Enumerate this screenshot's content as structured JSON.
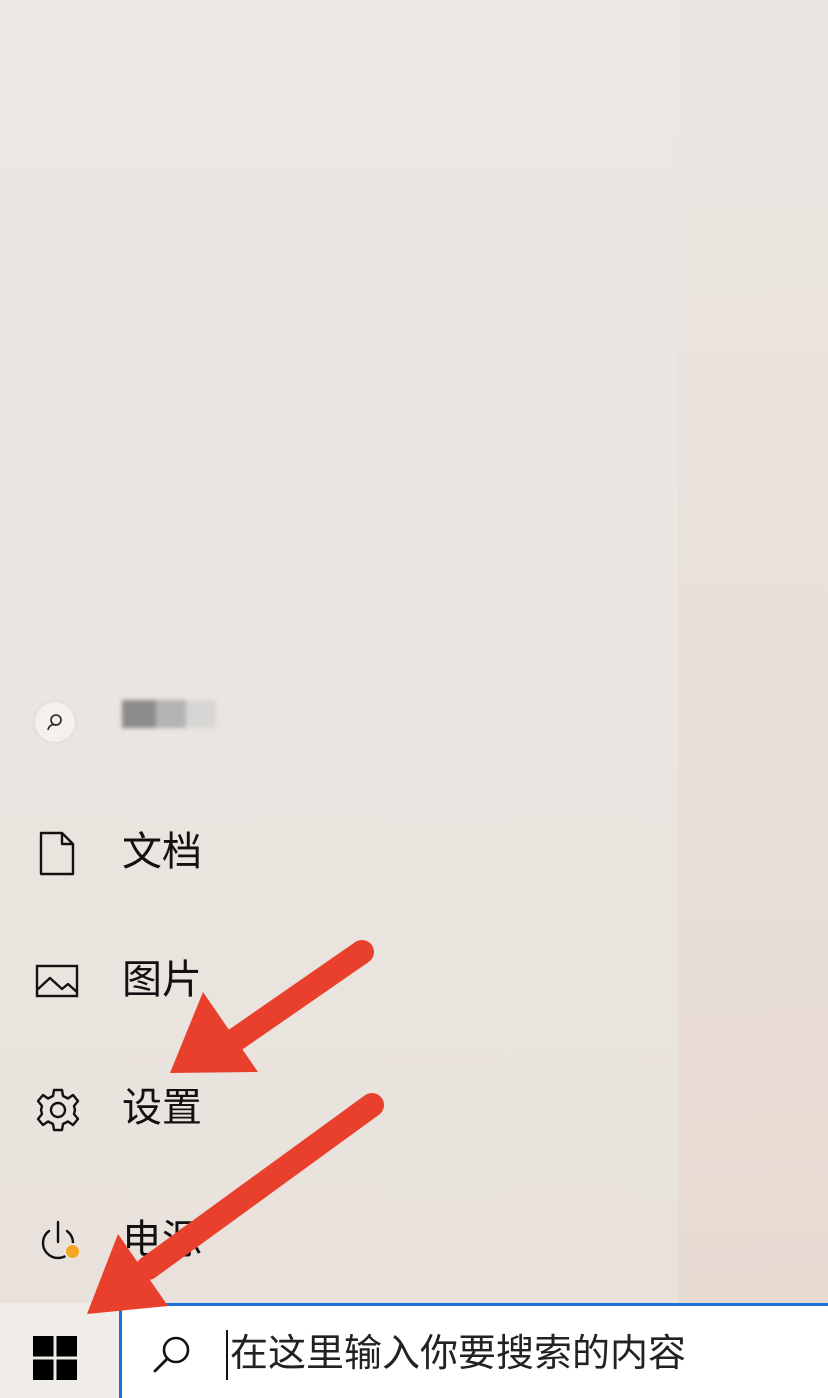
{
  "start_menu": {
    "account": {
      "icon": "user-icon",
      "name_blurred": true
    },
    "items": [
      {
        "label": "文档",
        "icon": "document-icon"
      },
      {
        "label": "图片",
        "icon": "picture-icon"
      },
      {
        "label": "设置",
        "icon": "gear-icon"
      },
      {
        "label": "电源",
        "icon": "power-icon",
        "badge_color": "#f5a623"
      }
    ]
  },
  "taskbar": {
    "start_icon": "windows-logo-icon",
    "search": {
      "icon": "search-icon",
      "placeholder": "在这里输入你要搜索的内容",
      "accent_color": "#1a73d9"
    }
  },
  "annotations": {
    "arrow_color": "#e8402c",
    "arrows": [
      "arrow-to-settings",
      "arrow-to-start-button"
    ]
  }
}
